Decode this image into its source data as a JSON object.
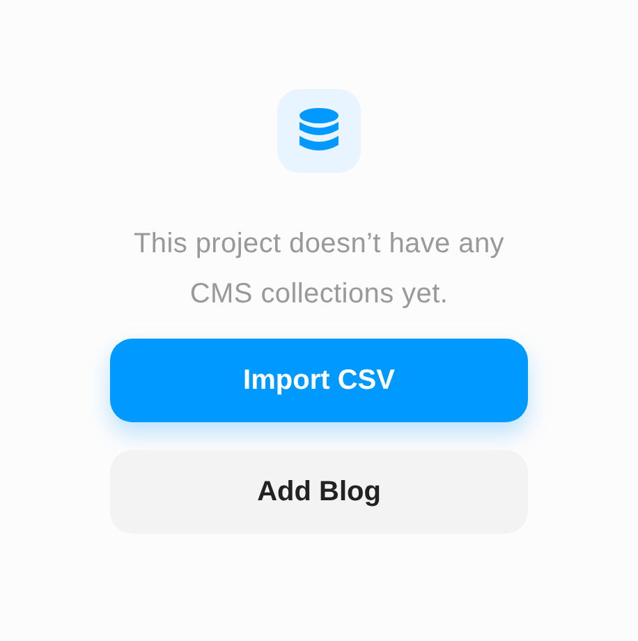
{
  "empty_state": {
    "message": "This project doesn’t have any CMS collections yet."
  },
  "buttons": [
    {
      "label": "Import CSV",
      "kind": "primary"
    },
    {
      "label": "Add Blog",
      "kind": "secondary"
    }
  ]
}
